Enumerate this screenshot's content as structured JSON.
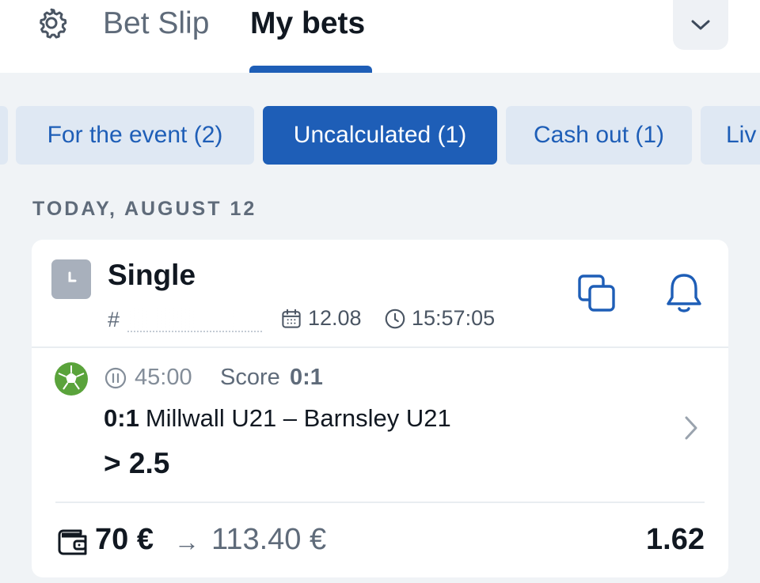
{
  "header": {
    "tabs": [
      {
        "label": "Bet Slip",
        "active": false
      },
      {
        "label": "My bets",
        "active": true
      }
    ],
    "icons": {
      "settings": "gear-icon",
      "collapse": "chevron-down-icon"
    }
  },
  "filters": {
    "chips": [
      {
        "label": "",
        "active": false
      },
      {
        "label": "For the event (2)",
        "active": false
      },
      {
        "label": "Uncalculated (1)",
        "active": true
      },
      {
        "label": "Cash out (1)",
        "active": false
      },
      {
        "label": "Liv",
        "active": false
      }
    ]
  },
  "date_header": "TODAY, AUGUST 12",
  "bet": {
    "type": "Single",
    "id_prefix": "#",
    "date": "12.08",
    "time": "15:57:05",
    "match_time": "45:00",
    "score_label": "Score",
    "score_value": "0:1",
    "event_score": "0:1",
    "event_name": "Millwall U21 – Barnsley U21",
    "selection": "> 2.5",
    "stake": "70 €",
    "arrow": "→",
    "payout": "113.40 €",
    "odds": "1.62"
  },
  "colors": {
    "accent": "#1e5eb7",
    "chip_bg": "#dfe8f3",
    "page_bg": "#f0f3f6",
    "muted_text": "#5f6b7a",
    "status_icon_bg": "#a8b0bc",
    "sport_icon": "#5aa33b"
  }
}
